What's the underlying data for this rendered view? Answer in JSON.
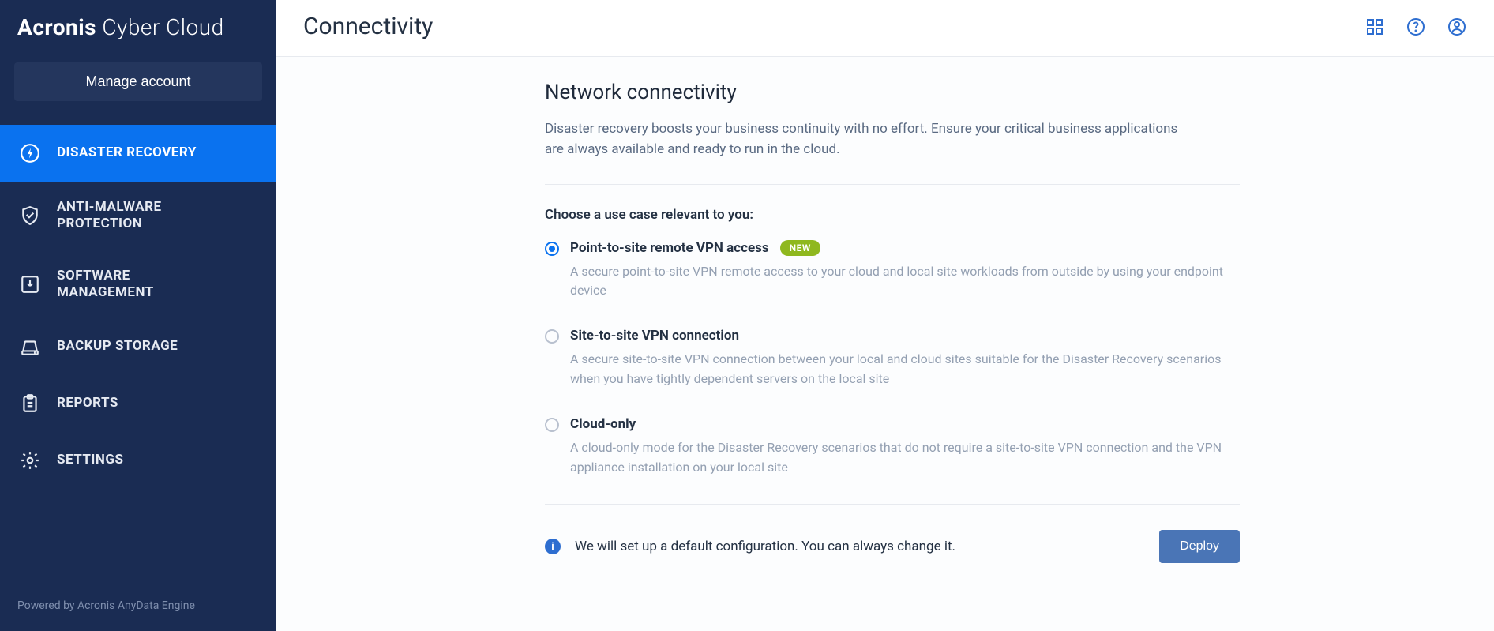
{
  "brand": {
    "bold": "Acronis",
    "light": " Cyber Cloud"
  },
  "sidebar": {
    "manage_label": "Manage account",
    "items": [
      {
        "label": "DISASTER RECOVERY",
        "icon": "bolt",
        "active": true
      },
      {
        "label": "ANTI-MALWARE PROTECTION",
        "icon": "shield",
        "active": false
      },
      {
        "label": "SOFTWARE MANAGEMENT",
        "icon": "download-box",
        "active": false
      },
      {
        "label": "BACKUP STORAGE",
        "icon": "disk",
        "active": false
      },
      {
        "label": "REPORTS",
        "icon": "clipboard",
        "active": false
      },
      {
        "label": "SETTINGS",
        "icon": "gear",
        "active": false
      }
    ],
    "powered": "Powered by Acronis AnyData Engine"
  },
  "header": {
    "title": "Connectivity"
  },
  "page": {
    "heading": "Network connectivity",
    "lead": "Disaster recovery boosts your business continuity with no effort. Ensure your critical business applications are always available and ready to run in the cloud.",
    "choose_label": "Choose a use case relevant to you:",
    "options": [
      {
        "title": "Point-to-site remote VPN access",
        "badge": "NEW",
        "description": "A secure point-to-site VPN remote access to your cloud and local site workloads from outside by using your endpoint device",
        "selected": true
      },
      {
        "title": "Site-to-site VPN connection",
        "badge": "",
        "description": "A secure site-to-site VPN connection between your local and cloud sites suitable for the Disaster Recovery scenarios when you have tightly dependent servers on the local site",
        "selected": false
      },
      {
        "title": "Cloud-only",
        "badge": "",
        "description": "A cloud-only mode for the Disaster Recovery scenarios that do not require a site-to-site VPN connection and the VPN appliance installation on your local site",
        "selected": false
      }
    ],
    "info_text": "We will set up a default configuration. You can always change it.",
    "deploy_label": "Deploy"
  }
}
